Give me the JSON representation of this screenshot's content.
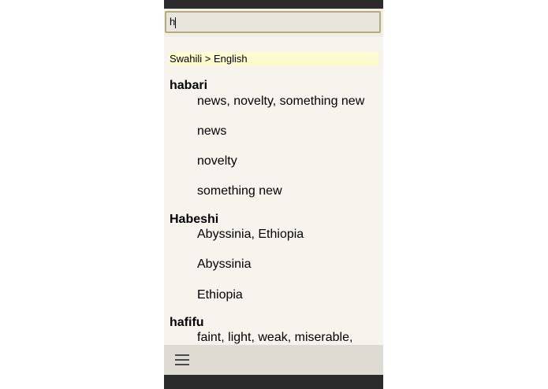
{
  "search": {
    "value": "h"
  },
  "results": {
    "language_header": "Swahili > English",
    "entries": [
      {
        "headword": "habari",
        "definitions": [
          "news, novelty, something new",
          "news",
          "novelty",
          "something new"
        ]
      },
      {
        "headword": "Habeshi",
        "definitions": [
          "Abyssinia, Ethiopia",
          "Abyssinia",
          "Ethiopia"
        ]
      },
      {
        "headword": "hafifu",
        "definitions": [
          "faint, light, weak, miserable,"
        ]
      }
    ]
  },
  "toolbar": {
    "menu_icon": "hamburger-menu-icon"
  },
  "colors": {
    "background": "#f7f4ee",
    "language_header_bg": "#fcfbcf",
    "search_border": "#b7ab7a",
    "bottom_bar": "#dedbd3",
    "system_bars": "#2b2b2b"
  }
}
